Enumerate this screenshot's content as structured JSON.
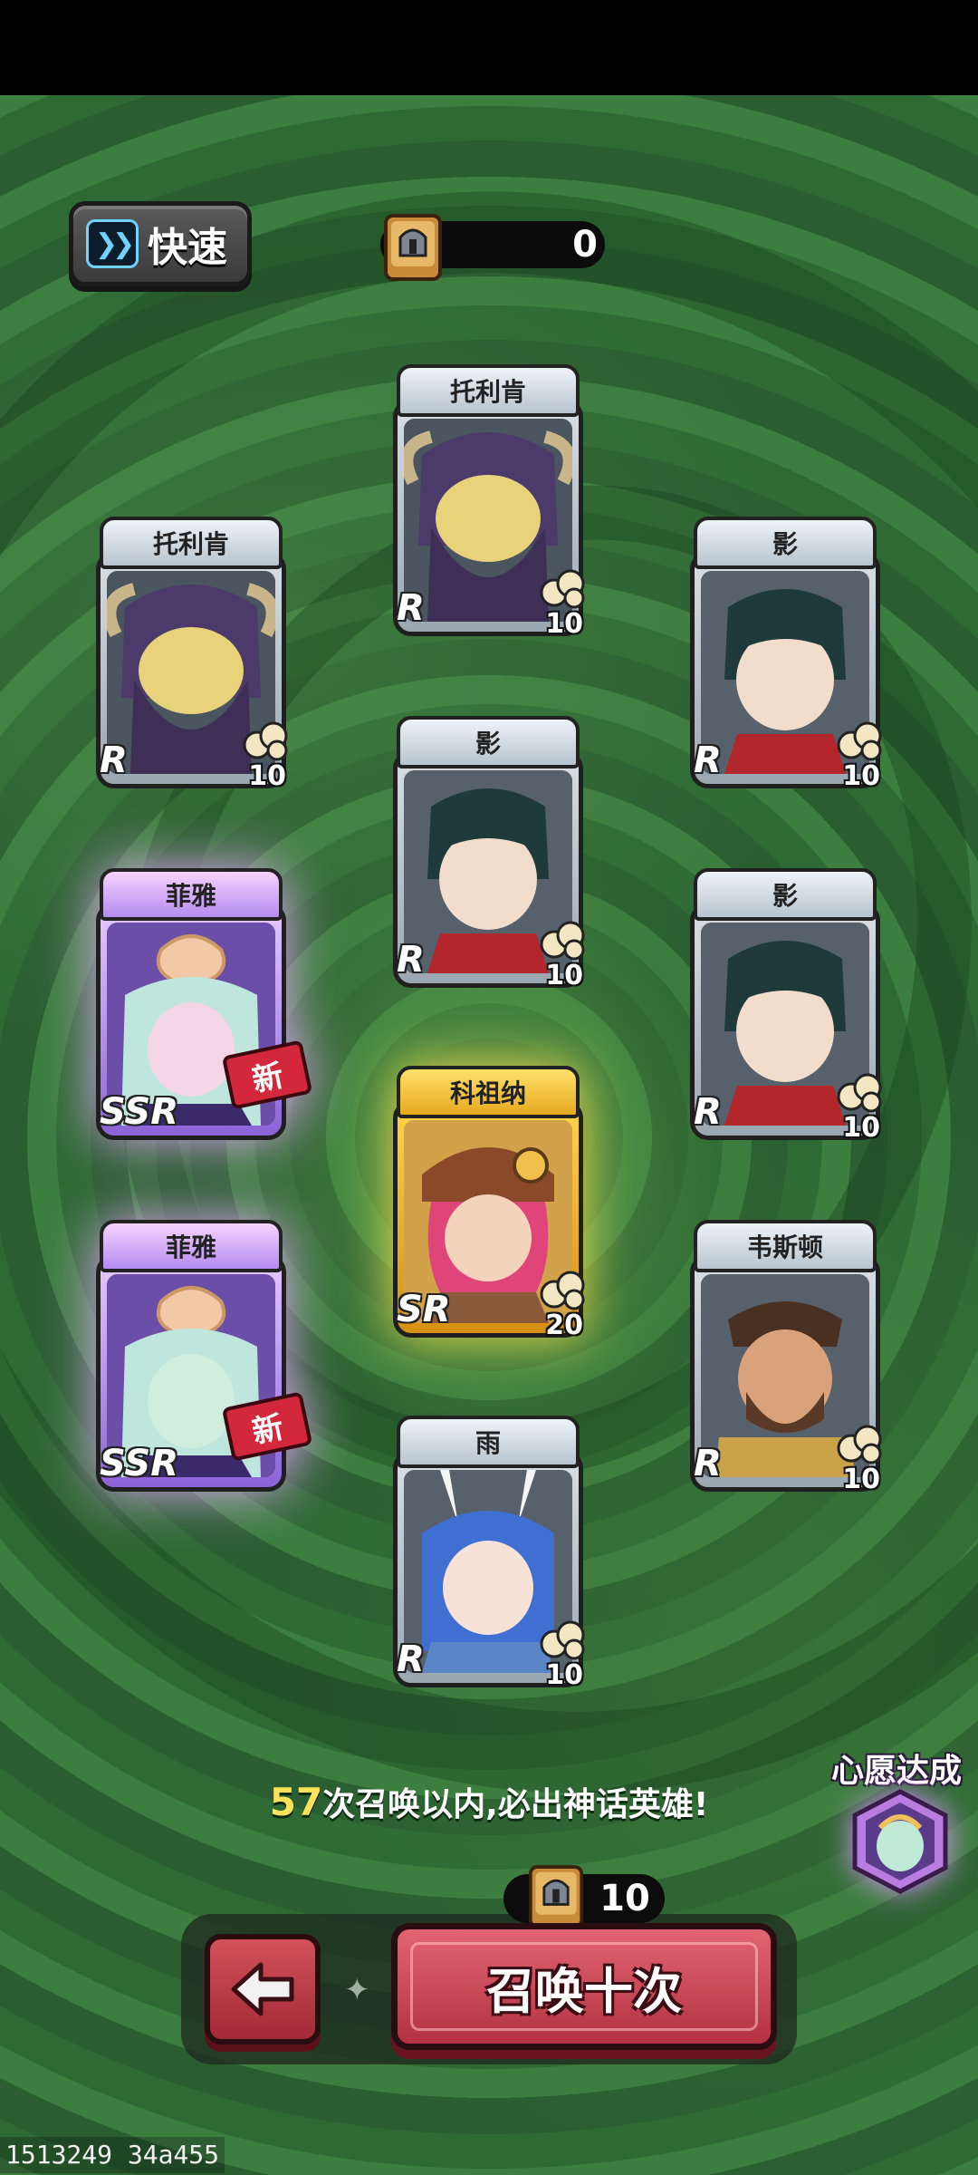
{
  "top_bar": {
    "speed_label": "快速",
    "currency_value": "0",
    "speed_icon": "fast-forward-icon",
    "currency_icon": "helmet-ticket-icon"
  },
  "cards": [
    {
      "name": "托利肯",
      "rarity": "R",
      "count": "10",
      "tier": "common",
      "is_new": false
    },
    {
      "name": "托利肯",
      "rarity": "R",
      "count": "10",
      "tier": "common",
      "is_new": false
    },
    {
      "name": "影",
      "rarity": "R",
      "count": "10",
      "tier": "common",
      "is_new": false
    },
    {
      "name": "影",
      "rarity": "R",
      "count": "10",
      "tier": "common",
      "is_new": false
    },
    {
      "name": "菲雅",
      "rarity": "SSR",
      "count": "",
      "tier": "ssr",
      "is_new": true,
      "new_label": "新"
    },
    {
      "name": "影",
      "rarity": "R",
      "count": "10",
      "tier": "common",
      "is_new": false
    },
    {
      "name": "科祖纳",
      "rarity": "SR",
      "count": "20",
      "tier": "sr",
      "is_new": false
    },
    {
      "name": "菲雅",
      "rarity": "SSR",
      "count": "",
      "tier": "ssr",
      "is_new": true,
      "new_label": "新"
    },
    {
      "name": "韦斯顿",
      "rarity": "R",
      "count": "10",
      "tier": "common",
      "is_new": false
    },
    {
      "name": "雨",
      "rarity": "R",
      "count": "10",
      "tier": "common",
      "is_new": false
    }
  ],
  "pity": {
    "count": "57",
    "text": "次召唤以内,必出神话英雄!"
  },
  "wish": {
    "label": "心愿达成"
  },
  "summon": {
    "cost": "10",
    "label": "召唤十次",
    "back_icon": "back-arrow-icon"
  },
  "footer": {
    "id_text": "1513249 34a455"
  },
  "colors": {
    "accent_red": "#c93a48",
    "pity_number": "#ffe25a",
    "background_green": "#2e6433"
  }
}
